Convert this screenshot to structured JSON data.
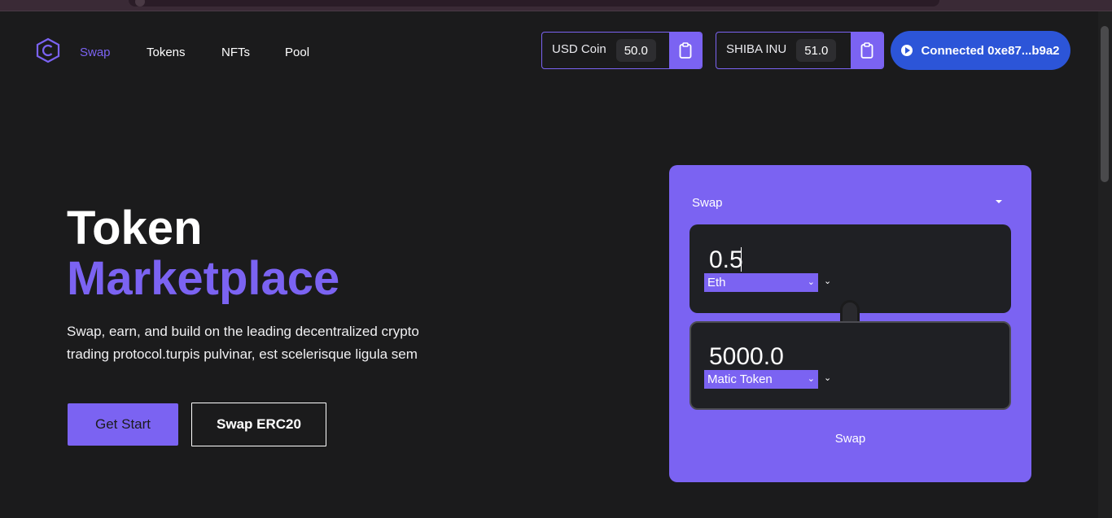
{
  "nav": {
    "links": [
      "Swap",
      "Tokens",
      "NFTs",
      "Pool"
    ]
  },
  "balances": [
    {
      "name": "USD Coin",
      "amount": "50.0"
    },
    {
      "name": "SHIBA INU",
      "amount": "51.0"
    }
  ],
  "wallet": {
    "label": "Connected 0xe87...b9a2"
  },
  "hero": {
    "title_line1": "Token",
    "title_line2": "Marketplace",
    "description": "Swap, earn, and build on the leading decentralized crypto trading protocol.turpis pulvinar, est scelerisque ligula sem",
    "primary_button": "Get Start",
    "secondary_button": "Swap ERC20"
  },
  "swap": {
    "heading": "Swap",
    "from_amount": "0.5",
    "from_token": "Eth",
    "to_amount": "5000.0",
    "to_token": "Matic Token",
    "submit_label": "Swap"
  },
  "colors": {
    "background": "#1b1b1c",
    "accent": "#7b63f2",
    "wallet_button": "#2c55d8"
  }
}
